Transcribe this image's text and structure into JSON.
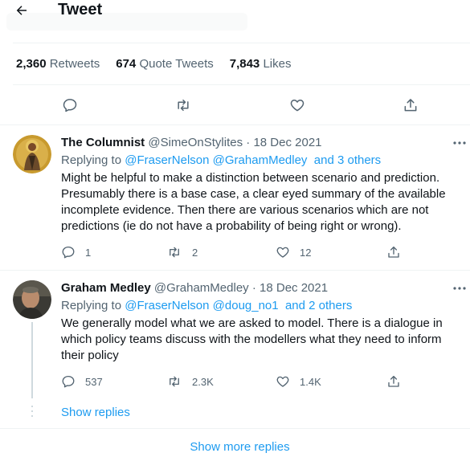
{
  "header": {
    "title": "Tweet"
  },
  "stats": [
    {
      "count": "2,360",
      "label": "Retweets"
    },
    {
      "count": "674",
      "label": "Quote Tweets"
    },
    {
      "count": "7,843",
      "label": "Likes"
    }
  ],
  "colors": {
    "accent": "#1d9bf0",
    "muted": "#536471",
    "text": "#0f1419",
    "divider": "#eff3f4"
  },
  "tweets": [
    {
      "name": "The Columnist",
      "handle": "@SimeOnStylites",
      "dot": "·",
      "date": "18 Dec 2021",
      "replying_prefix": "Replying to",
      "replying_to": [
        "@FraserNelson",
        "@GrahamMedley"
      ],
      "replying_others": "and 3 others",
      "text": "Might be helpful to make a distinction between scenario and prediction. Presumably there is a base case, a clear eyed summary of the available incomplete evidence. Then there are various scenarios which are not predictions (ie do not have a probability of being right or wrong).",
      "replies": "1",
      "retweets": "2",
      "likes": "12"
    },
    {
      "name": "Graham Medley",
      "handle": "@GrahamMedley",
      "dot": "·",
      "date": "18 Dec 2021",
      "replying_prefix": "Replying to",
      "replying_to": [
        "@FraserNelson",
        "@doug_no1"
      ],
      "replying_others": "and 2 others",
      "text": "We generally model what we are asked to model. There is a dialogue in which policy teams discuss with the modellers what they need to inform their policy",
      "replies": "537",
      "retweets": "2.3K",
      "likes": "1.4K"
    }
  ],
  "show_replies": "Show replies",
  "show_more_replies": "Show more replies"
}
